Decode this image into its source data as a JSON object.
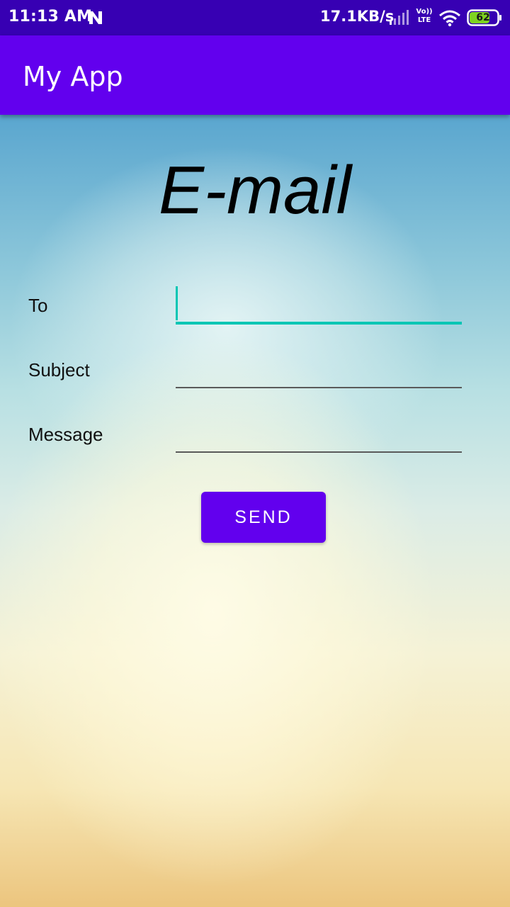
{
  "status_bar": {
    "time": "11:13 AM",
    "notification_icon": "n-icon",
    "network_speed": "17.1KB/s",
    "signal_icon": "signal-bars-icon",
    "volte_line1": "Vo))",
    "volte_line2": "LTE",
    "wifi_icon": "wifi-icon",
    "battery_level": "62",
    "battery_color": "#7ed321"
  },
  "app_bar": {
    "title": "My App",
    "color": "#6200ee"
  },
  "form": {
    "heading": "E-mail",
    "fields": [
      {
        "label": "To",
        "value": "",
        "focused": true
      },
      {
        "label": "Subject",
        "value": "",
        "focused": false
      },
      {
        "label": "Message",
        "value": "",
        "focused": false
      }
    ],
    "send_label": "SEND"
  },
  "colors": {
    "status_bar": "#3700b3",
    "accent": "#03c6b4",
    "button": "#6200ee"
  }
}
